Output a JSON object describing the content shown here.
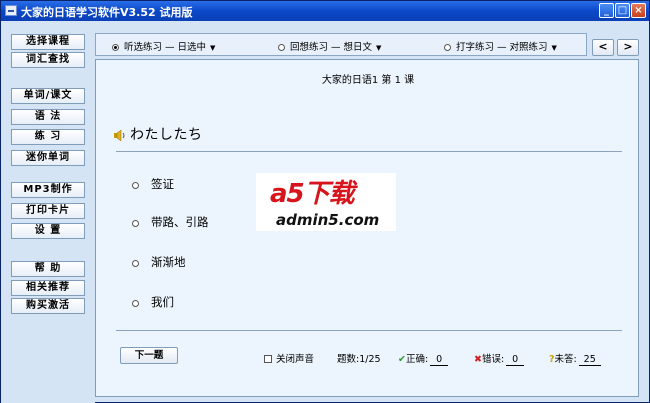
{
  "window": {
    "title": "大家的日语学习软件V3.52 试用版"
  },
  "sidebar": {
    "items": [
      {
        "label": "选择课程"
      },
      {
        "label": "词汇查找"
      },
      {
        "label": "单词/课文"
      },
      {
        "label": "语 法"
      },
      {
        "label": "练 习"
      },
      {
        "label": "迷你单词"
      },
      {
        "label": "MP3制作"
      },
      {
        "label": "打印卡片"
      },
      {
        "label": "设 置"
      },
      {
        "label": "帮 助"
      },
      {
        "label": "相关推荐"
      },
      {
        "label": "购买激活"
      }
    ]
  },
  "modes": [
    {
      "label": "听选练习 — 日选中",
      "selected": true
    },
    {
      "label": "回想练习 — 想日文",
      "selected": false
    },
    {
      "label": "打字练习 — 对照练习",
      "selected": false
    }
  ],
  "nav": {
    "prev": "<",
    "next": ">"
  },
  "main": {
    "lesson_title": "大家的日语1 第 1 课",
    "word": "わたしたち",
    "options": [
      {
        "label": "签证"
      },
      {
        "label": "带路、引路"
      },
      {
        "label": "渐渐地"
      },
      {
        "label": "我们"
      }
    ],
    "next_button": "下一题",
    "mute_label": "关闭声音",
    "progress_label": "题数:1/25",
    "correct_label": "正确:",
    "correct_value": "0",
    "wrong_label": "错误:",
    "wrong_value": "0",
    "unanswered_label": "未答:",
    "unanswered_value": "25"
  },
  "watermark": {
    "top": "a5下载",
    "bottom": "admin5.com"
  },
  "colors": {
    "accent": "#0b48c8",
    "panel": "#ecf4fd",
    "background": "#d4e4f4",
    "logo_red": "#d7141c"
  }
}
